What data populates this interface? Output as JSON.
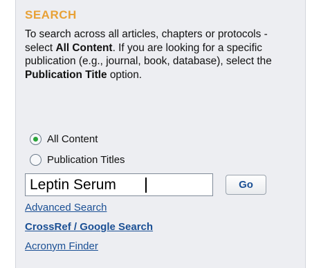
{
  "search": {
    "title": "SEARCH",
    "description": {
      "part1": "To search across all articles, chapters or protocols - select ",
      "bold1": "All Content",
      "part2": ". If you are looking for a specific publication (e.g., journal, book, database), select the ",
      "bold2": "Publication Title",
      "part3": " option."
    },
    "options": [
      {
        "label": "All Content",
        "selected": true
      },
      {
        "label": "Publication Titles",
        "selected": false
      }
    ],
    "input_value": "Leptin Serum",
    "go_label": "Go",
    "links": [
      "Advanced Search",
      "CrossRef / Google Search",
      "Acronym Finder"
    ],
    "colors": {
      "title": "#e8a136",
      "link": "#1a4f94",
      "panel": "#edeef2",
      "radio_selected": "#2aa43a"
    }
  }
}
